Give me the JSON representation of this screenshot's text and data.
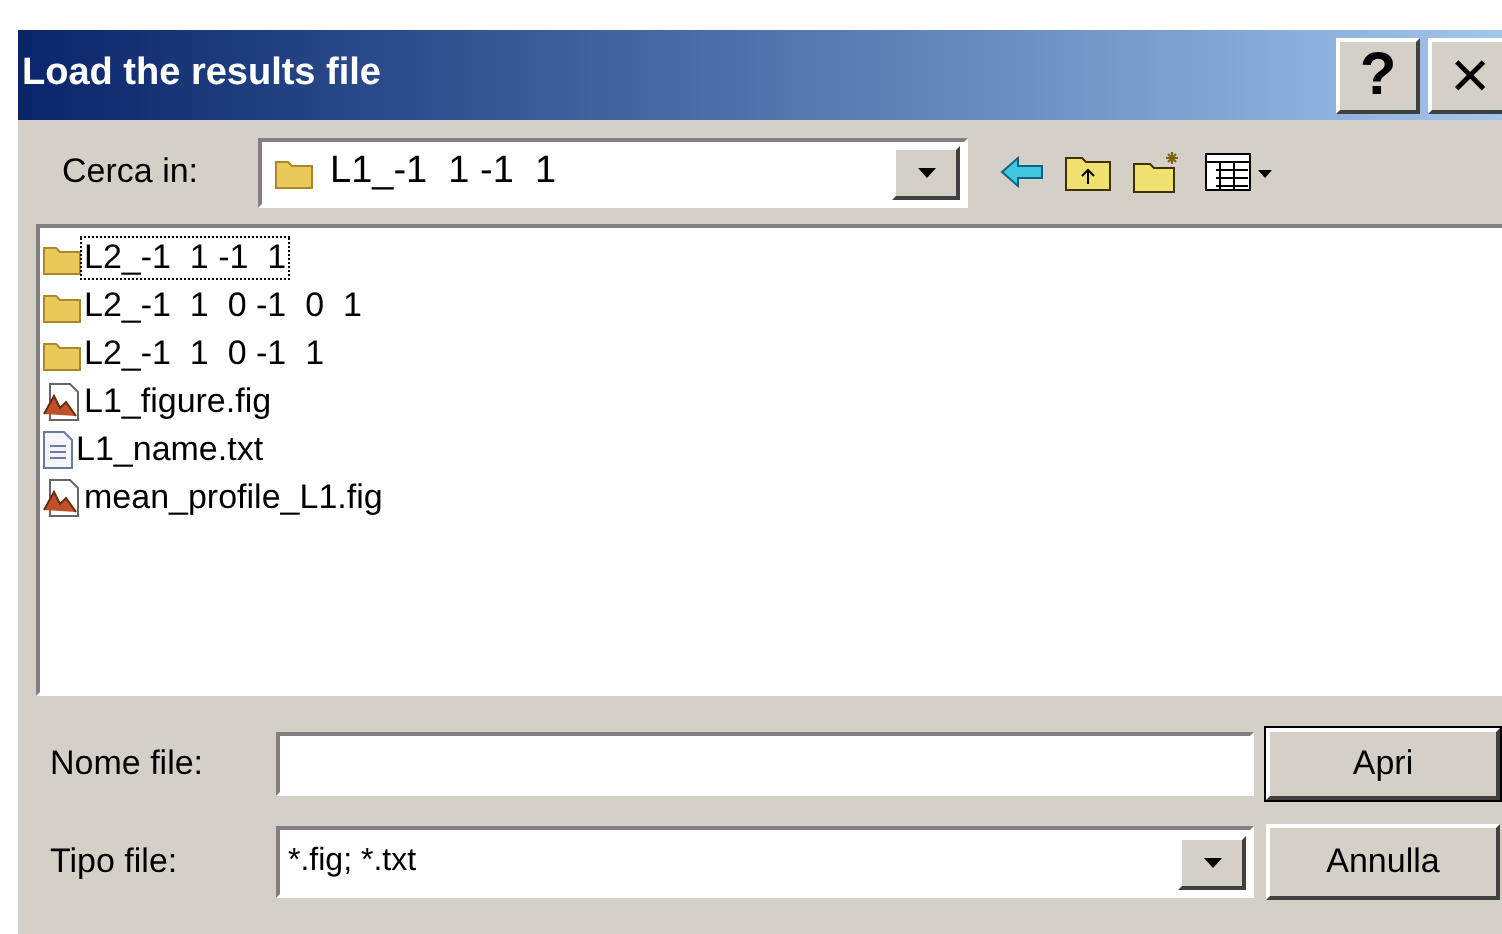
{
  "window": {
    "title": "Load the results file",
    "help_button": "?",
    "close_button": "×"
  },
  "look_in": {
    "label": "Cerca in:",
    "value": "L1_-1  1 -1  1"
  },
  "files": [
    {
      "name": "L2_-1  1 -1  1",
      "kind": "folder",
      "selected": true
    },
    {
      "name": "L2_-1  1  0 -1  0  1",
      "kind": "folder",
      "selected": false
    },
    {
      "name": "L2_-1  1  0 -1  1",
      "kind": "folder",
      "selected": false
    },
    {
      "name": "L1_figure.fig",
      "kind": "fig",
      "selected": false
    },
    {
      "name": "L1_name.txt",
      "kind": "txt",
      "selected": false
    },
    {
      "name": "mean_profile_L1.fig",
      "kind": "fig",
      "selected": false
    }
  ],
  "file_name": {
    "label": "Nome file:"
  },
  "file_type": {
    "label": "Tipo file:",
    "value": "*.fig; *.txt"
  },
  "buttons": [
    "Apri",
    "Annulla"
  ]
}
